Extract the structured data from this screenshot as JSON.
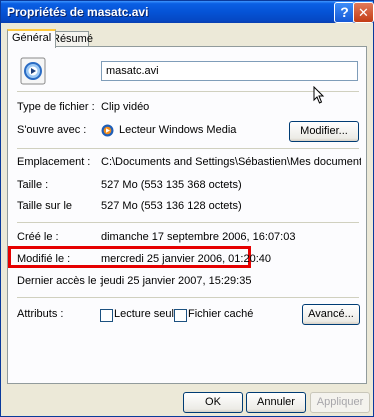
{
  "window": {
    "title": "Propriétés de masatc.avi",
    "help_symbol": "?",
    "close_symbol": "✕"
  },
  "tabs": [
    {
      "label": "Général",
      "selected": true
    },
    {
      "label": "Résumé",
      "selected": false
    }
  ],
  "general": {
    "file_name": "masatc.avi",
    "file_type_label": "Type de fichier :",
    "file_type_value": "Clip vidéo",
    "opens_with_label": "S'ouvre avec :",
    "opens_with_value": "Lecteur Windows Media",
    "modify_button": "Modifier...",
    "location_label": "Emplacement :",
    "location_value": "C:\\Documents and Settings\\Sébastien\\Mes documents\\Mes vidéo",
    "size_label": "Taille :",
    "size_value": "527 Mo (553 135 368 octets)",
    "size_on_disk_label": "Taille sur le",
    "size_on_disk_value": "527 Mo (553 136 128 octets)",
    "created_label": "Créé le :",
    "created_value": "dimanche 17 septembre 2006, 16:07:03",
    "modified_label": "Modifié le :",
    "modified_value": "mercredi 25 janvier 2006, 01:20:40",
    "accessed_label": "Dernier accès le :",
    "accessed_value": "jeudi 25 janvier 2007, 15:29:35",
    "attributes_label": "Attributs :",
    "readonly_label": "Lecture seule",
    "readonly_checked": false,
    "hidden_label": "Fichier caché",
    "hidden_checked": false,
    "advanced_button": "Avancé..."
  },
  "footer": {
    "ok_label": "OK",
    "cancel_label": "Annuler",
    "apply_label": "Appliquer",
    "apply_enabled": false
  },
  "colors": {
    "titlebar": "#0553D6",
    "highlight_border": "#E60000",
    "dialog_bg": "#ECE9D8",
    "tab_accent": "#FFC83C"
  },
  "icons": [
    "help-icon",
    "close-icon",
    "video-file-icon",
    "windows-media-player-icon",
    "mouse-cursor-icon"
  ]
}
